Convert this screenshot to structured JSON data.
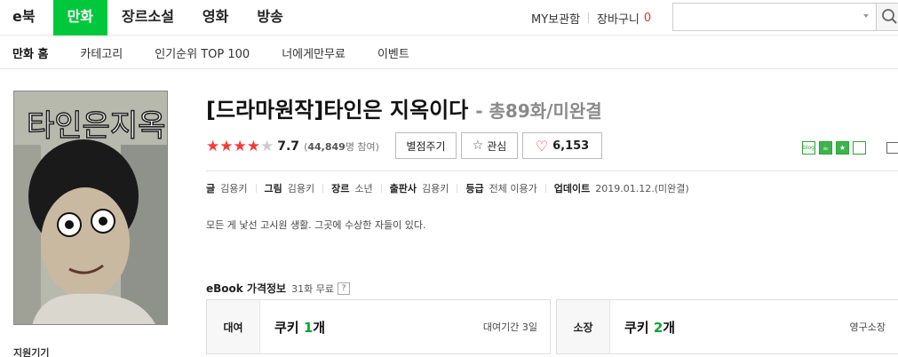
{
  "topnav": {
    "menu": [
      "e북",
      "만화",
      "장르소설",
      "영화",
      "방송"
    ],
    "active_index": 1,
    "my_library": "MY보관함",
    "cart_label": "장바구니",
    "cart_count": "0",
    "search_placeholder": ""
  },
  "subnav": [
    "만화 홈",
    "카테고리",
    "인기순위 TOP 100",
    "너에게만무료",
    "이벤트"
  ],
  "cover": {
    "art_text": "타인은지옥이다"
  },
  "side": {
    "guide_label": "지원기기"
  },
  "product": {
    "title": "[드라마원작]타인은 지옥이다",
    "meta": "- 총89화/미완결",
    "rating": {
      "stars_filled": 4,
      "stars_total": 5,
      "score": "7.7",
      "votes_open": "(",
      "votes_count": "44,849",
      "votes_suffix": "명 참여)"
    },
    "rate_button": "별점주기",
    "fav_button": "관심",
    "like_count": "6,153",
    "info": [
      {
        "k": "글",
        "v": "김용키"
      },
      {
        "k": "그림",
        "v": "김용키"
      },
      {
        "k": "장르",
        "v": "소년"
      },
      {
        "k": "출판사",
        "v": "김용키"
      },
      {
        "k": "등급",
        "v": "전체 이용가"
      },
      {
        "k": "업데이트",
        "v": "2019.01.12.(미완결)"
      }
    ],
    "description": "모든 게 낯선 고시원 생활. 그곳에 수상한 자들이 있다."
  },
  "price": {
    "title": "eBook 가격정보",
    "free_count": "31화 무료",
    "help": "?",
    "rent": {
      "label": "대여",
      "cookie_word": "쿠키",
      "cookie_num": "1",
      "cookie_unit": "개",
      "period": "대여기간 3일"
    },
    "own": {
      "label": "소장",
      "cookie_word": "쿠키",
      "cookie_num": "2",
      "cookie_unit": "개",
      "period": "영구소장"
    }
  },
  "colors": {
    "brand_green": "#00c73c",
    "star_red": "#f33b3b",
    "cart_red": "#e8342e"
  },
  "icons": [
    "search-icon",
    "star-icon",
    "heart-icon",
    "blog-icon",
    "cafe-icon",
    "bookmark-star-icon",
    "share-box-icon",
    "share-icon"
  ]
}
